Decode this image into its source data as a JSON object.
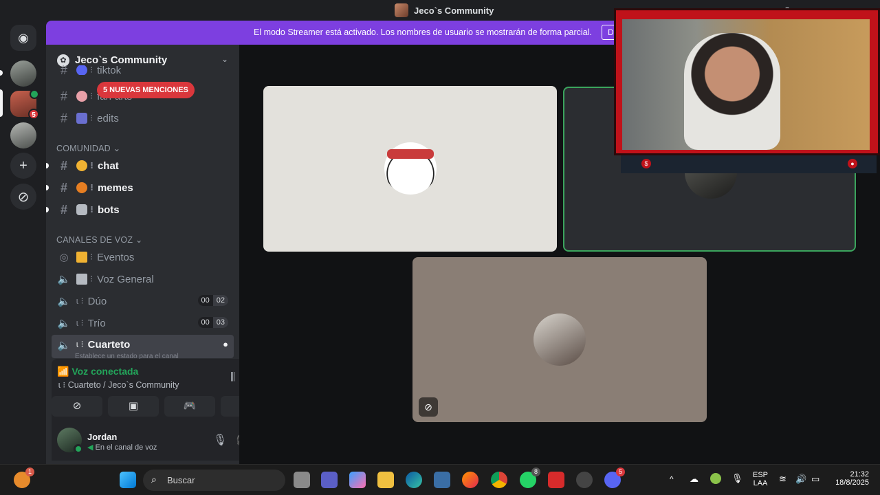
{
  "window": {
    "title": "Jeco`s Community"
  },
  "banner": {
    "text": "El modo Streamer está activado. Los nombres de usuario se mostrarán de forma parcial.",
    "button_label": "D"
  },
  "server": {
    "name": "Jeco`s Community",
    "mentions_badge": "5 NUEVAS MENCIONES"
  },
  "rail": {
    "dm_badge": "5"
  },
  "channels_top": [
    {
      "label": "tiktok"
    },
    {
      "label": "fan-arts"
    },
    {
      "label": "edits"
    }
  ],
  "categories": {
    "community": "COMUNIDAD",
    "voice": "CANALES DE VOZ"
  },
  "community_channels": [
    {
      "label": "chat"
    },
    {
      "label": "memes"
    },
    {
      "label": "bots"
    }
  ],
  "voice_channels": [
    {
      "label": "Eventos"
    },
    {
      "label": "Voz General"
    },
    {
      "label": "Dúo",
      "count_a": "00",
      "count_b": "02"
    },
    {
      "label": "Trío",
      "count_a": "00",
      "count_b": "03"
    },
    {
      "label": "Cuarteto"
    }
  ],
  "voice_hint": "Establece un estado para el canal",
  "voice_panel": {
    "status": "Voz conectada",
    "location": "Cuarteto / Jeco`s Community"
  },
  "user": {
    "name": "Jordan",
    "status": "En el canal de voz"
  },
  "taskbar": {
    "search_placeholder": "Buscar",
    "lang_top": "ESP",
    "lang_bottom": "LAA",
    "time": "21:32",
    "date": "18/8/2025",
    "discord_badge": "5",
    "widget_badge": "1",
    "whatsapp_badge": "8"
  },
  "colors": {
    "accent_banner": "#7d3fe0",
    "connected": "#23a55a",
    "mention": "#da373c",
    "speaking_border": "#3ba55d"
  }
}
